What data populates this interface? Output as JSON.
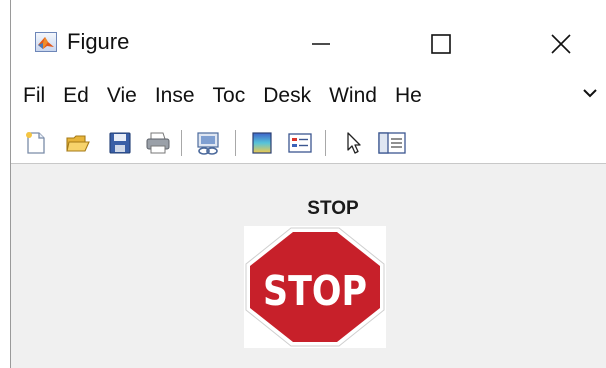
{
  "window": {
    "title": "Figure",
    "controls": {
      "minimize": "minimize-icon",
      "maximize": "maximize-icon",
      "close": "close-icon"
    }
  },
  "menubar": {
    "items": [
      {
        "label": "Fil"
      },
      {
        "label": "Ed"
      },
      {
        "label": "Vie"
      },
      {
        "label": "Inse"
      },
      {
        "label": "Toc"
      },
      {
        "label": "Desk"
      },
      {
        "label": "Wind"
      },
      {
        "label": "He"
      }
    ],
    "overflow_icon": "chevron-more-icon"
  },
  "toolbar": {
    "icons": [
      "new-figure-icon",
      "open-folder-icon",
      "save-icon",
      "print-icon",
      "link-plot-icon",
      "insert-colorbar-icon",
      "insert-legend-icon",
      "edit-plot-cursor-icon",
      "property-inspector-icon"
    ]
  },
  "figure": {
    "axes_title": "STOP",
    "image": {
      "sign_text": "STOP",
      "colors": {
        "sign_red": "#c7202a",
        "border": "#ffffff"
      }
    }
  },
  "colors": {
    "figure_background": "#f0f0f0",
    "window_background": "#ffffff"
  }
}
